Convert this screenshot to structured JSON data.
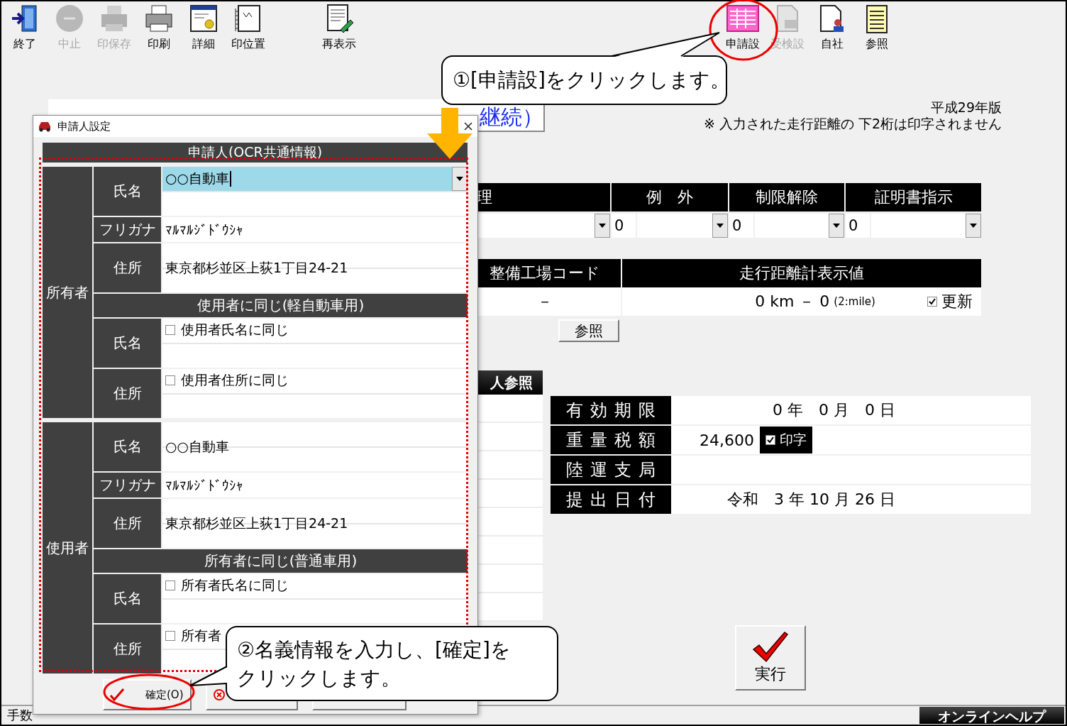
{
  "toolbar": {
    "groups": [
      {
        "items": [
          {
            "kind": "exit",
            "label": "終了",
            "disabled": false
          },
          {
            "kind": "stop",
            "label": "中止",
            "disabled": true
          },
          {
            "kind": "save-print",
            "label": "印保存",
            "disabled": true
          },
          {
            "kind": "print",
            "label": "印刷",
            "disabled": false
          },
          {
            "kind": "details",
            "label": "詳細",
            "disabled": false
          },
          {
            "kind": "print-position",
            "label": "印位置",
            "disabled": false
          }
        ]
      },
      {
        "items": [
          {
            "kind": "refresh",
            "label": "再表示",
            "disabled": false
          }
        ]
      },
      {
        "items": [
          {
            "kind": "application",
            "label": "申請設",
            "disabled": false
          },
          {
            "kind": "inspection",
            "label": "受検設",
            "disabled": true
          },
          {
            "kind": "company",
            "label": "自社",
            "disabled": false
          },
          {
            "kind": "reference",
            "label": "参照",
            "disabled": false
          }
        ]
      }
    ]
  },
  "form_title": "継続）",
  "edition": "平成29年版",
  "note": "※ 入力された走行距離の 下2桁は印字されません",
  "options_table": {
    "columns": [
      "理",
      "例　外",
      "制限解除",
      "証明書指示"
    ],
    "cells": [
      {
        "kind": "combo"
      },
      {
        "kind": "coded-combo",
        "code": "0"
      },
      {
        "kind": "coded-combo",
        "code": "0"
      },
      {
        "kind": "coded-combo",
        "code": "0"
      }
    ]
  },
  "inspection_table": {
    "columns": [
      "整備工場コード",
      "走行距離計表示値"
    ],
    "factory_code": "－",
    "odometer": "0 km －  0",
    "odometer_unit_note": "(2:mile)",
    "update": {
      "label": "更新",
      "checked": true
    }
  },
  "reference_button": "参照",
  "applicant_reference_button": "人参照",
  "info_rows": [
    {
      "label": "有効期限",
      "value": "0 年　0 月　0 日"
    },
    {
      "label": "重量税額",
      "value": "24,600",
      "print": {
        "label": "印字",
        "checked": true
      }
    },
    {
      "label": "陸運支局"
    },
    {
      "label": "提出日付",
      "value": "令和　3 年 10 月 26 日"
    }
  ],
  "execute_button": "実行",
  "status_bar": {
    "message": "手数",
    "help_button": "オンラインヘルプ"
  },
  "dialog": {
    "title": "申請人設定",
    "header": "申請人(OCR共通情報)",
    "sections": [
      {
        "label": "所有者",
        "rows": [
          {
            "kind": "combo",
            "label": "氏名",
            "value": "○○自動車",
            "focused": true
          },
          {
            "kind": "text",
            "label": "フリガナ",
            "value": "ﾏﾙﾏﾙｼﾞﾄﾞｳｼｬ"
          },
          {
            "kind": "text",
            "label": "住所",
            "value": "東京都杉並区上荻1丁目24-21"
          },
          {
            "kind": "subheader",
            "label": "使用者に同じ(軽自動車用)"
          },
          {
            "kind": "checkbox",
            "label": "氏名",
            "text": "使用者氏名に同じ",
            "checked": false
          },
          {
            "kind": "checkbox",
            "label": "住所",
            "text": "使用者住所に同じ",
            "checked": false
          }
        ]
      },
      {
        "label": "使用者",
        "rows": [
          {
            "kind": "text",
            "label": "氏名",
            "value": "○○自動車"
          },
          {
            "kind": "text",
            "label": "フリガナ",
            "value": "ﾏﾙﾏﾙｼﾞﾄﾞｳｼｬ"
          },
          {
            "kind": "text",
            "label": "住所",
            "value": "東京都杉並区上荻1丁目24-21"
          },
          {
            "kind": "subheader",
            "label": "所有者に同じ(普通車用)"
          },
          {
            "kind": "checkbox",
            "label": "氏名",
            "text": "所有者氏名に同じ",
            "checked": false
          },
          {
            "kind": "checkbox",
            "label": "住所",
            "text": "所有者",
            "checked": false
          }
        ]
      }
    ],
    "buttons": [
      {
        "kind": "confirm",
        "label": "確定(O)"
      },
      {
        "kind": "cancel"
      },
      {
        "kind": "plain"
      }
    ]
  },
  "callouts": [
    {
      "text": "①[申請設]をクリックします。"
    },
    {
      "text": "②名義情報を入力し、[確定]をクリックします。"
    }
  ]
}
